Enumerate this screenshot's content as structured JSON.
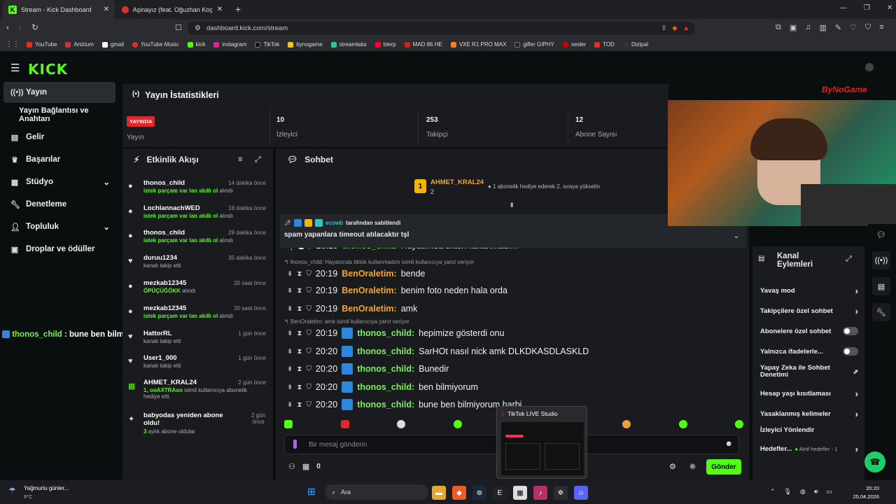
{
  "browser": {
    "tabs": [
      {
        "label": "Stream - Kick Dashboard"
      },
      {
        "label": "Aşinayız (feat. Oğuzhan Koç) | Yo"
      }
    ],
    "url": "dashboard.kick.com/stream",
    "bookmarks": [
      "YouTube",
      "Anizium",
      "gmail",
      "YouTube Music",
      "kick",
      "instagram",
      "TikTok",
      "bynogame",
      "streamlabs",
      "blerp",
      "MAD 86 HE",
      "VXE R1 PRO MAX",
      "gifler GIPHY",
      "sesler",
      "TOD",
      "Dizipal"
    ]
  },
  "sidebar": {
    "logo": "KICK",
    "items": [
      {
        "label": "Yayın",
        "icon": "broadcast-icon"
      },
      {
        "label": "Yayın Bağlantısı ve Anahtarı",
        "icon": ""
      },
      {
        "label": "Gelir",
        "icon": "chart-icon"
      },
      {
        "label": "Başarılar",
        "icon": "trophy-icon"
      },
      {
        "label": "Stüdyo",
        "icon": "grid-icon"
      },
      {
        "label": "Denetleme",
        "icon": "wrench-icon"
      },
      {
        "label": "Topluluk",
        "icon": "user-icon"
      },
      {
        "label": "Droplar ve ödüller",
        "icon": "gift-icon"
      }
    ]
  },
  "stats": {
    "title": "Yayın İstatistikleri",
    "live_badge": "YAYINDA",
    "live_label": "Yayın",
    "viewers": {
      "value": "10",
      "label": "İzleyici"
    },
    "followers": {
      "value": "253",
      "label": "Takipçi"
    },
    "subs": {
      "value": "12",
      "label": "Abone Sayısı"
    }
  },
  "events": {
    "title": "Etkinlik Akışı",
    "items": [
      {
        "name": "thonos_child",
        "time": "14 dakika önce",
        "detail_hl": "istek parçam var lan akıllı ol",
        "detail": " alındı"
      },
      {
        "name": "LochlannachWED",
        "time": "18 dakika önce",
        "detail_hl": "istek parçam var lan akıllı ol",
        "detail": " alındı"
      },
      {
        "name": "thonos_child",
        "time": "29 dakika önce",
        "detail_hl": "istek parçam var lan akıllı ol",
        "detail": " alındı"
      },
      {
        "name": "duruu1234",
        "time": "35 dakika önce",
        "detail_hl": "",
        "detail": "kanalı takip etti"
      },
      {
        "name": "mezkab12345",
        "time": "20 saat önce",
        "detail_hl": "ÖPÜÇÜĞÖKK",
        "detail": " alındı"
      },
      {
        "name": "mezkab12345",
        "time": "20 saat önce",
        "detail_hl": "istek parçam var lan akıllı ol",
        "detail": " alındı"
      },
      {
        "name": "HattorRL",
        "time": "1 gün önce",
        "detail_hl": "",
        "detail": "kanalı takip etti"
      },
      {
        "name": "User1_000",
        "time": "1 gün önce",
        "detail_hl": "",
        "detail": "kanalı takip etti"
      },
      {
        "name": "AHMET_KRAL24",
        "time": "2 gün önce",
        "detail_hl": "1, ooAXTRAoo",
        "detail": " isimli kullanıcıya abonelik hediye etti."
      },
      {
        "name": "babyodas yeniden abone oldu!",
        "time": "2 gün önce",
        "detail_hl": "3",
        "detail": " aylık abone oldular"
      }
    ]
  },
  "chat": {
    "title": "Sohbet",
    "top_gifter": {
      "name": "AHMET_KRAL24",
      "count": "2",
      "note": "1 abonelik hediye ederek 2. sıraya yükselin"
    },
    "pinned": {
      "by": "ecowb",
      "by_suffix": " tarafından sabitlendi",
      "text": "spam yapanlara timeout atılacaktır tşl"
    },
    "partial_top": "20:19",
    "partial_user": "thonos_child",
    "partial_text": "Hayatımda tiktok kullanmadım",
    "messages": [
      {
        "reply": "thonos_child: Hayatımda tiktok kullanmadım isimli kullanıcıya yanıt veriyor",
        "time": "20:19",
        "user": "BenOraletim",
        "color": "o",
        "text": "bende"
      },
      {
        "reply": "",
        "time": "20:19",
        "user": "BenOraletim",
        "color": "o",
        "text": "benim foto neden hala orda"
      },
      {
        "reply": "",
        "time": "20:19",
        "user": "BenOraletim",
        "color": "o",
        "text": "amk"
      },
      {
        "reply": "BenOraletim: amk isimli kullanıcıya yanıt veriyor",
        "time": "20:19",
        "user": "thonos_child",
        "color": "g",
        "text": "hepimize gösterdi onu"
      },
      {
        "reply": "",
        "time": "20:20",
        "user": "thonos_child",
        "color": "g",
        "text": "SarHOt nasıl nick amk DLKDKASDLASKLD"
      },
      {
        "reply": "",
        "time": "20:20",
        "user": "thonos_child",
        "color": "g",
        "text": "Bunedir"
      },
      {
        "reply": "",
        "time": "20:20",
        "user": "thonos_child",
        "color": "g",
        "text": "ben bilmiyorum"
      },
      {
        "reply": "",
        "time": "20:20",
        "user": "thonos_child",
        "color": "g",
        "text": "bune ben bilmiyorum harbi"
      }
    ],
    "input_placeholder": "Bir mesaj gönderin",
    "points": "0",
    "send_label": "Gönder"
  },
  "actions": {
    "title": "Kanal Eylemleri",
    "items": [
      {
        "label": "Yavaş mod",
        "type": "arrow"
      },
      {
        "label": "Takipçilere özel sohbet",
        "type": "arrow"
      },
      {
        "label": "Abonelere özel sohbet",
        "type": "toggle"
      },
      {
        "label": "Yalnızca ifadelerle...",
        "type": "toggle"
      },
      {
        "label": "Yapay Zeka ile Sohbet Denetimi",
        "type": "ext"
      },
      {
        "label": "Hesap yaşı kısıtlaması",
        "type": "arrow"
      },
      {
        "label": "Yasaklanmış kelimeler",
        "type": "arrow"
      },
      {
        "label": "İzleyici Yönlendir",
        "type": "none"
      },
      {
        "label": "Hedefler...",
        "type": "arrow",
        "extra": "Aktif hedefler - 1"
      }
    ]
  },
  "overlay": {
    "user": "thonos_child",
    "text": " : bune ben bilmiyorum harbi"
  },
  "webcam_watermark": "ByNoGame",
  "tiktok_popup": {
    "title": "TikTok LIVE Studio"
  },
  "taskbar": {
    "weather": "Yağmurlu günler...",
    "temp": "9°C",
    "search": "Ara",
    "time": "20:20",
    "date": "25.04.2026"
  },
  "colors": {
    "accent": "#53fc18",
    "panel": "#191b1f",
    "bg": "#0b0e0f"
  }
}
